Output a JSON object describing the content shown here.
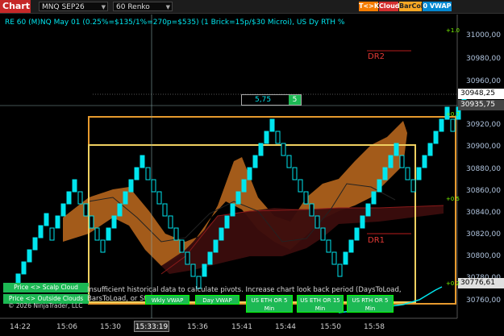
{
  "toolbar": {
    "chart_label": "Chart",
    "instrument": "MNQ SEP26",
    "timeframe": "60 Renko",
    "buttons": [
      {
        "label": "T<>K",
        "color": "#f57c00"
      },
      {
        "label": "Cloud",
        "color": "#d32f2f"
      },
      {
        "label": "BarCol",
        "color": "#f9a825"
      },
      {
        "label": "0 VWAP",
        "color": "#0288d1"
      }
    ]
  },
  "title": "RE 60 (M)NQ May 01 (0.25%=$135/1%=270p=$535) (1 Brick=15p/$30 Microi), US Dy RTH %",
  "price_axis": {
    "labels": [
      "31000,00",
      "30980,00",
      "30960,00",
      "30920,00",
      "30900,00",
      "30880,00",
      "30860,00",
      "30840,00",
      "30820,00",
      "30800,00",
      "30780,00",
      "30760,00"
    ],
    "last_price": "30948,25",
    "cursor_price": "30935,75",
    "bottom_price": "30776,61"
  },
  "pct_labels": [
    "+1.0",
    "+0.7",
    "+0.5",
    "+0.2"
  ],
  "time_axis": [
    "14:22",
    "15:06",
    "15:30",
    "15:36",
    "15:41",
    "15:44",
    "15:50",
    "15:58"
  ],
  "cursor_time": "15:33:19",
  "cursor_box": {
    "value": "5,75",
    "count": "5"
  },
  "dr_labels": {
    "dr2": "DR2",
    "dr1": "DR1"
  },
  "left_buttons": {
    "scalp": "Price <> Scalp Cloud",
    "outside": "Price <> Outside Clouds"
  },
  "bottom_buttons": [
    "Wkly VWAP",
    "Day VWAP",
    "US ETH OR 5 Min",
    "US ETH OR 15 Min",
    "US RTH OR 5 Min"
  ],
  "message": "Insufficient historical data to calculate pivots. Increase chart look back period (DaysToLoad, BarsToLoad, or Start Date).",
  "copyright": "© 2026 NinjaTrader, LLC",
  "colors": {
    "brick_up": "#00e5ee",
    "brick_down": "#3aa0b0",
    "cloud": "#b5651d",
    "dark_cloud": "#3b0d0d",
    "orange_box": "#e69a2e",
    "yellow_box": "#f0d060"
  }
}
